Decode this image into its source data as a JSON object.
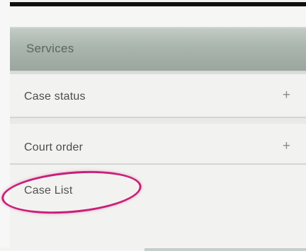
{
  "menu": {
    "section_title": "Services",
    "items": [
      {
        "label": "Case status",
        "icon": "plus-icon",
        "expand_symbol": "+"
      },
      {
        "label": "Court order",
        "icon": "plus-icon",
        "expand_symbol": "+"
      },
      {
        "label": "Case List"
      }
    ]
  },
  "annotation": {
    "color": "#c81f78"
  }
}
